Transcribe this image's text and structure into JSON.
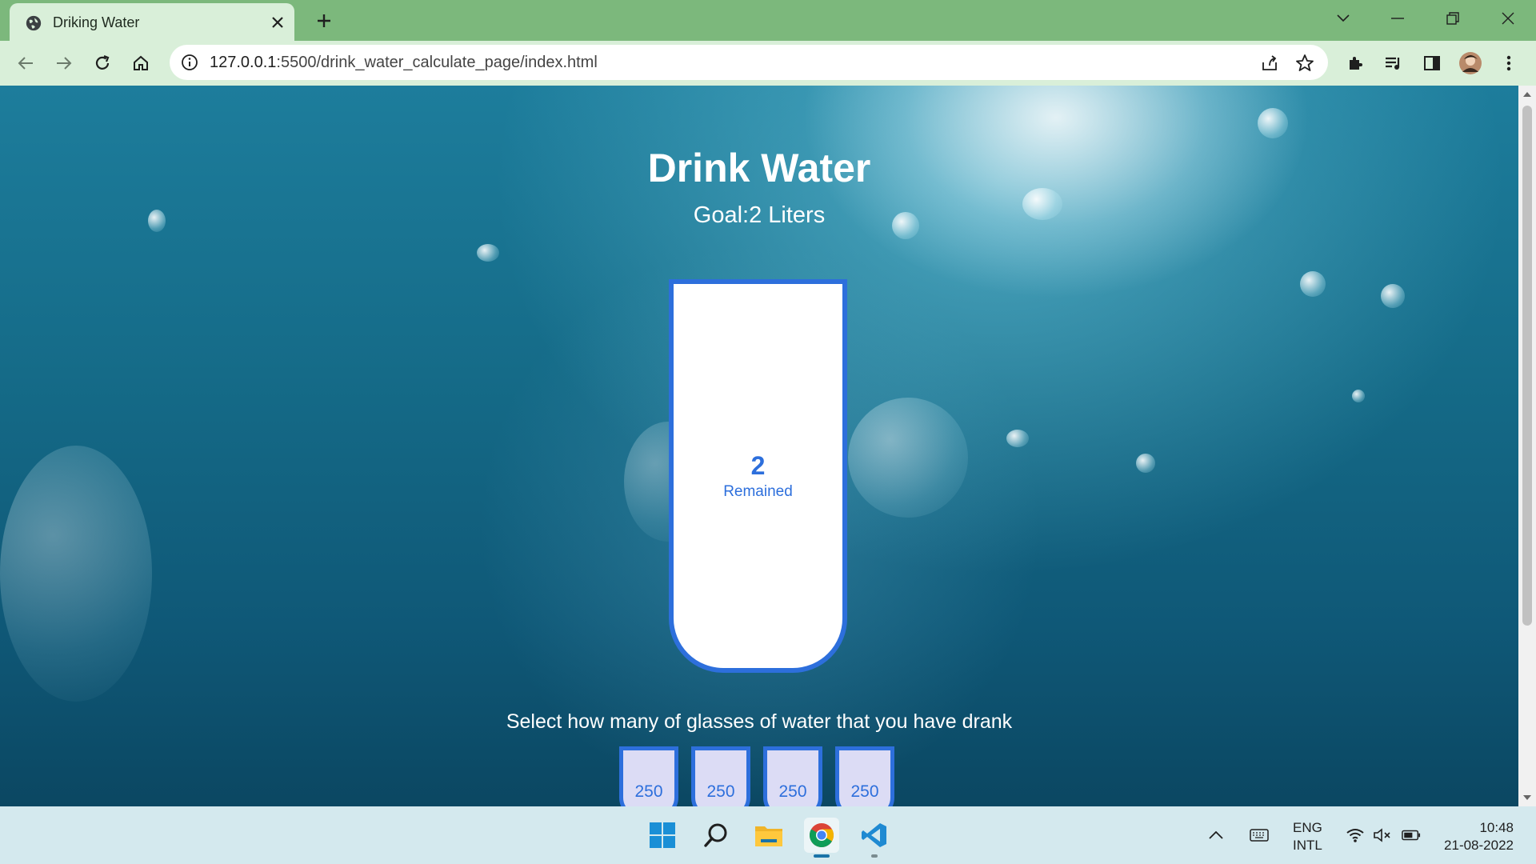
{
  "browser": {
    "tab_title": "Driking Water",
    "url_host": "127.0.0.1",
    "url_path": ":5500/drink_water_calculate_page/index.html"
  },
  "page": {
    "title": "Drink Water",
    "goal": "Goal:2 Liters",
    "remained_value": "2",
    "remained_label": "Remained",
    "select_prompt": "Select how many of glasses of water that you have drank",
    "cups": [
      {
        "label": "250"
      },
      {
        "label": "250"
      },
      {
        "label": "250"
      },
      {
        "label": "250"
      }
    ]
  },
  "taskbar": {
    "lang_primary": "ENG",
    "lang_secondary": "INTL",
    "time": "10:48",
    "date": "21-08-2022"
  },
  "colors": {
    "accent": "#2d6fdc",
    "tabstrip": "#7cb87c",
    "toolbar": "#d9efd9"
  }
}
